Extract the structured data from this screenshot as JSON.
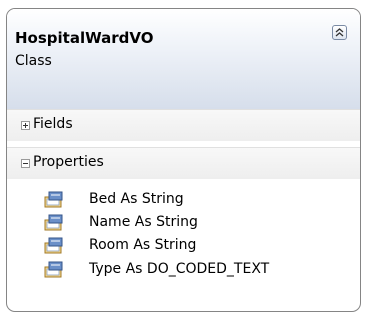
{
  "class": {
    "name": "HospitalWardVO",
    "kind": "Class"
  },
  "sections": {
    "fields": {
      "label": "Fields",
      "state": "collapsed"
    },
    "properties": {
      "label": "Properties",
      "state": "expanded"
    }
  },
  "properties": [
    {
      "label": "Bed As String",
      "icon": "property-icon"
    },
    {
      "label": "Name As String",
      "icon": "property-icon"
    },
    {
      "label": "Room As String",
      "icon": "property-icon"
    },
    {
      "label": "Type As DO_CODED_TEXT",
      "icon": "property-icon"
    }
  ],
  "colors": {
    "border": "#858585",
    "header_gradient_end": "#d6deeb"
  }
}
